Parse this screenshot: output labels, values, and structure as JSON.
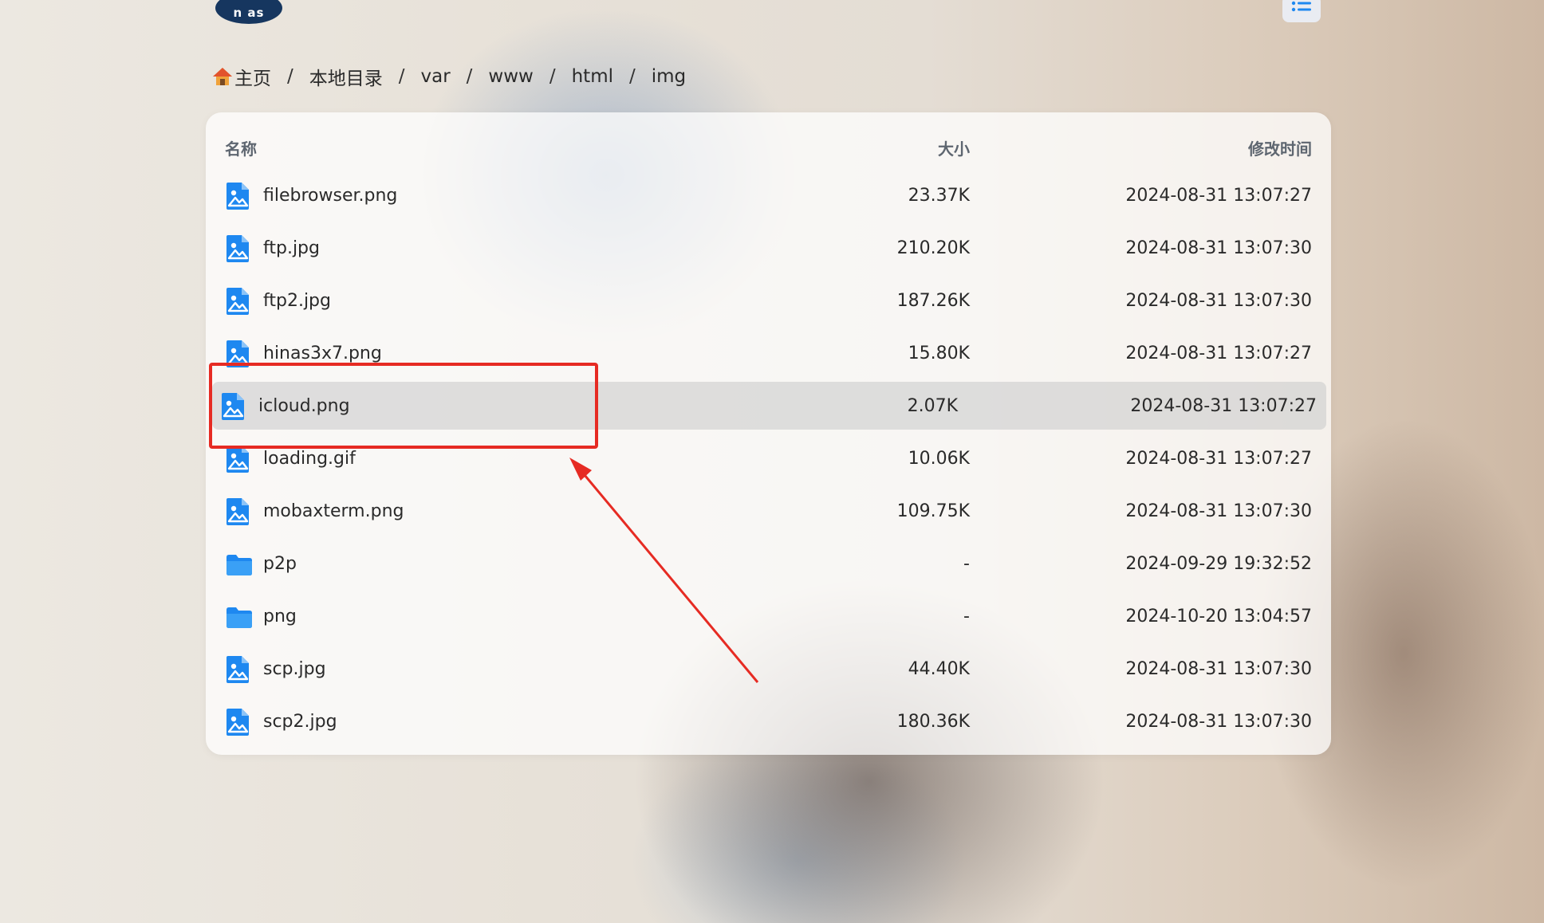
{
  "app": {
    "logo_text": "n as"
  },
  "breadcrumb": [
    {
      "label": "主页"
    },
    {
      "label": "本地目录"
    },
    {
      "label": "var"
    },
    {
      "label": "www"
    },
    {
      "label": "html"
    },
    {
      "label": "img"
    }
  ],
  "breadcrumb_separator": "/",
  "table": {
    "headers": {
      "name": "名称",
      "size": "大小",
      "modified": "修改时间"
    },
    "rows": [
      {
        "icon": "image-file-icon",
        "name": "filebrowser.png",
        "size": "23.37K",
        "modified": "2024-08-31 13:07:27"
      },
      {
        "icon": "image-file-icon",
        "name": "ftp.jpg",
        "size": "210.20K",
        "modified": "2024-08-31 13:07:30"
      },
      {
        "icon": "image-file-icon",
        "name": "ftp2.jpg",
        "size": "187.26K",
        "modified": "2024-08-31 13:07:30"
      },
      {
        "icon": "image-file-icon",
        "name": "hinas3x7.png",
        "size": "15.80K",
        "modified": "2024-08-31 13:07:27"
      },
      {
        "icon": "image-file-icon",
        "name": "icloud.png",
        "size": "2.07K",
        "modified": "2024-08-31 13:07:27",
        "selected": true
      },
      {
        "icon": "image-file-icon",
        "name": "loading.gif",
        "size": "10.06K",
        "modified": "2024-08-31 13:07:27"
      },
      {
        "icon": "image-file-icon",
        "name": "mobaxterm.png",
        "size": "109.75K",
        "modified": "2024-08-31 13:07:30"
      },
      {
        "icon": "folder-icon",
        "name": "p2p",
        "size": "-",
        "modified": "2024-09-29 19:32:52"
      },
      {
        "icon": "folder-icon",
        "name": "png",
        "size": "-",
        "modified": "2024-10-20 13:04:57"
      },
      {
        "icon": "image-file-icon",
        "name": "scp.jpg",
        "size": "44.40K",
        "modified": "2024-08-31 13:07:30"
      },
      {
        "icon": "image-file-icon",
        "name": "scp2.jpg",
        "size": "180.36K",
        "modified": "2024-08-31 13:07:30"
      }
    ]
  },
  "colors": {
    "icon_blue": "#1e88f0",
    "annotation_red": "#e62b23",
    "logo_navy": "#16365f"
  }
}
